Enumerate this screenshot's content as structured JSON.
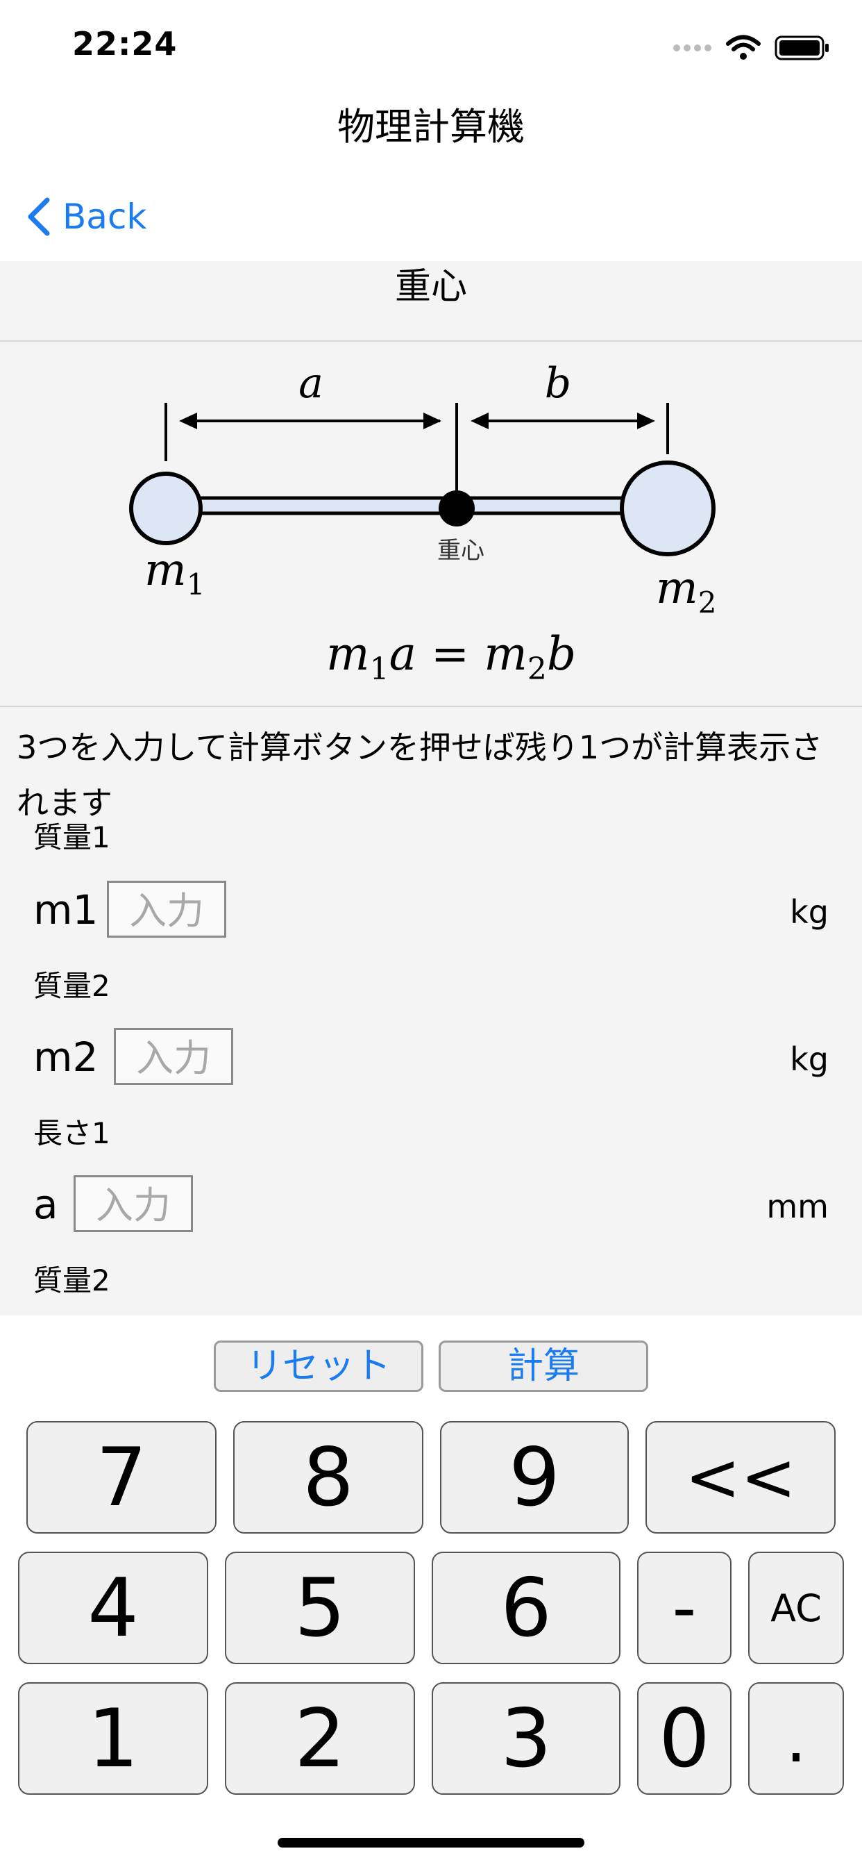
{
  "status_bar": {
    "time": "22:24"
  },
  "nav": {
    "title": "物理計算機",
    "back_label": "Back"
  },
  "section": {
    "title": "重心"
  },
  "diagram": {
    "label_a": "a",
    "label_b": "b",
    "center_label": "重心",
    "m1": "m",
    "m1_sub": "1",
    "m2": "m",
    "m2_sub": "2",
    "formula": {
      "m1": "m",
      "s1": "1",
      "a": "a",
      "eq": " = ",
      "m2": "m",
      "s2": "2",
      "b": "b"
    }
  },
  "instruction": "3つを入力して計算ボタンを押せば残り1つが計算表示されます",
  "fields": [
    {
      "group_label": "質量1",
      "var": "m1",
      "placeholder": "入力",
      "unit": "kg"
    },
    {
      "group_label": "質量2",
      "var": "m2",
      "placeholder": "入力",
      "unit": "kg"
    },
    {
      "group_label": "長さ1",
      "var": "a",
      "placeholder": "入力",
      "unit": "mm"
    }
  ],
  "next_group_label": "質量2",
  "actions": {
    "reset": "リセット",
    "calculate": "計算"
  },
  "keypad": {
    "row1": [
      "7",
      "8",
      "9",
      "<<"
    ],
    "row2": [
      "4",
      "5",
      "6",
      "-",
      "AC"
    ],
    "row3": [
      "1",
      "2",
      "3",
      "0",
      "."
    ]
  }
}
